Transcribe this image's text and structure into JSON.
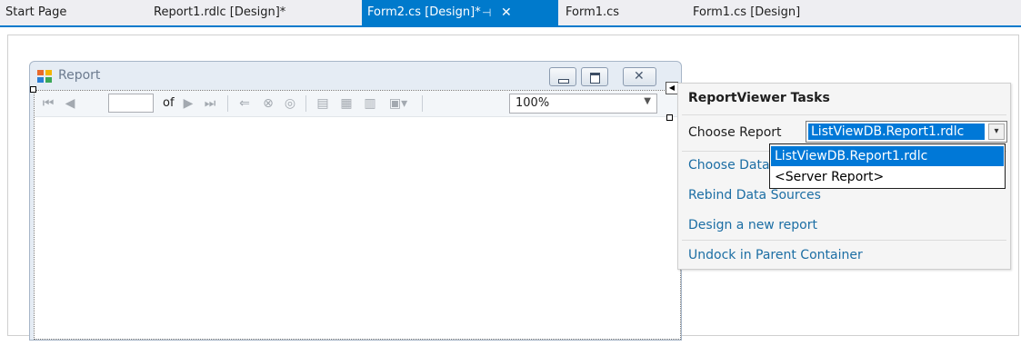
{
  "tabs": [
    {
      "label": "Start Page"
    },
    {
      "label": "Report1.rdlc [Design]*"
    },
    {
      "label": "Form2.cs [Design]*",
      "active": true
    },
    {
      "label": "Form1.cs"
    },
    {
      "label": "Form1.cs [Design]"
    }
  ],
  "form": {
    "title": "Report",
    "page_of_label": "of",
    "zoom_value": "100%"
  },
  "tasks_panel": {
    "title": "ReportViewer Tasks",
    "choose_report_label": "Choose Report",
    "selected_report": "ListViewDB.Report1.rdlc",
    "dropdown_options": [
      "ListViewDB.Report1.rdlc",
      "<Server Report>"
    ],
    "links": {
      "choose_data": "Choose Data Sources",
      "rebind": "Rebind Data Sources",
      "design": "Design a new report",
      "undock": "Undock in Parent Container"
    }
  },
  "colors": {
    "accent": "#007acc",
    "selection": "#0078d7",
    "link": "#1c6ea4"
  }
}
